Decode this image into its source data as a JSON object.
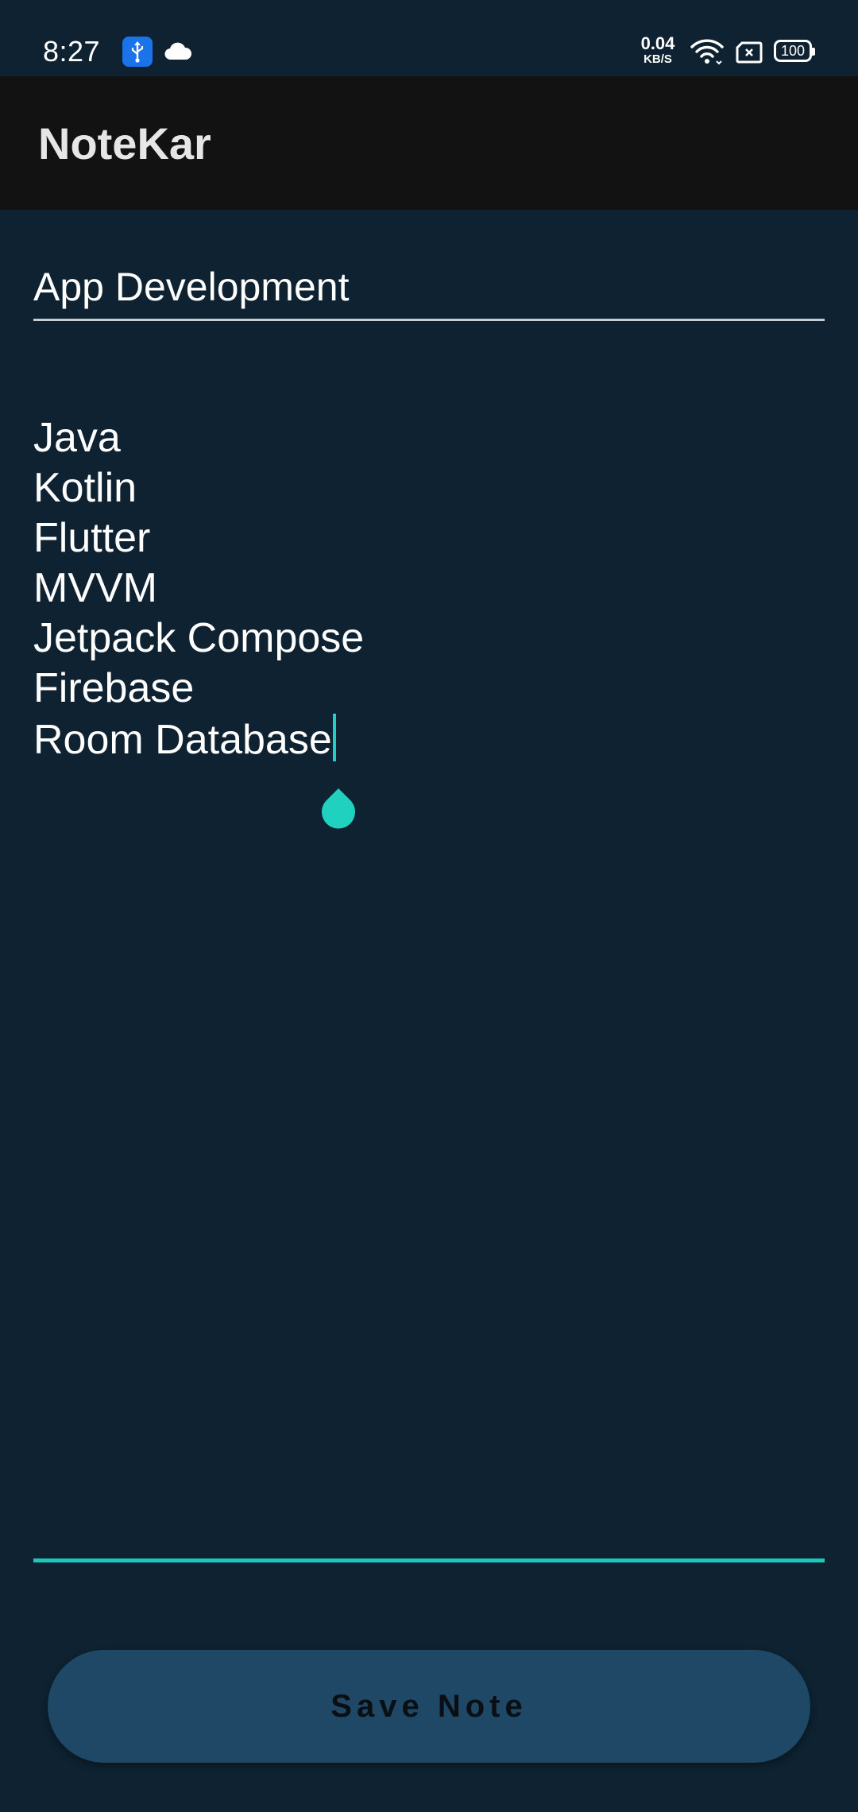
{
  "status_bar": {
    "time": "8:27",
    "net_speed_value": "0.04",
    "net_speed_unit": "KB/S",
    "battery_level": "100",
    "icons": [
      "usb-debug-icon",
      "cloud-icon",
      "wifi-icon",
      "sim-icon",
      "battery-icon"
    ]
  },
  "app_bar": {
    "title": "NoteKar"
  },
  "editor": {
    "title_value": "App Development",
    "body_lines": [
      "Java",
      "Kotlin",
      "Flutter",
      "MVVM",
      "Jetpack Compose",
      "Firebase",
      "Room Database"
    ]
  },
  "actions": {
    "save_label": "Save Note"
  },
  "colors": {
    "background": "#0e2231",
    "app_bar": "#121212",
    "accent": "#1fc7b6",
    "button": "#1e4866",
    "usb_badge": "#1a73e8"
  }
}
